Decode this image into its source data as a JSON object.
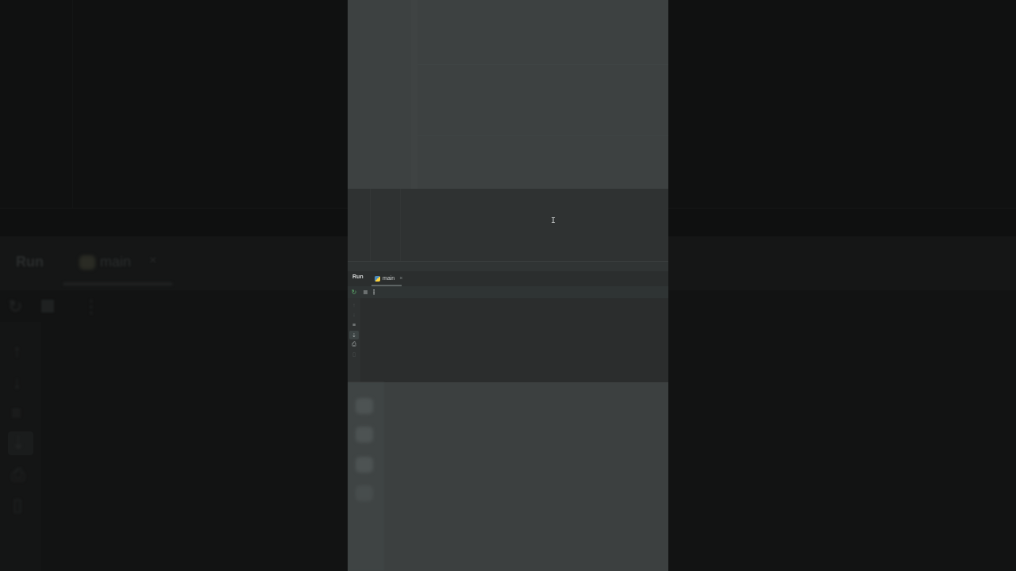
{
  "run_panel": {
    "title": "Run",
    "tab": {
      "label": "main",
      "icon": "python-icon",
      "close": "×"
    }
  },
  "toolbar": {
    "rerun_icon": "↻",
    "more_icon": "⋮"
  },
  "editor": {
    "caret_glyph": "I"
  },
  "side_tools": [
    {
      "name": "scroll-up-icon",
      "glyph": "↑"
    },
    {
      "name": "scroll-down-icon",
      "glyph": "↓"
    },
    {
      "name": "soft-wrap-icon",
      "glyph": "≡"
    },
    {
      "name": "scroll-to-end-icon",
      "glyph": "⇣"
    },
    {
      "name": "print-icon",
      "glyph": "⎙"
    },
    {
      "name": "trash-icon",
      "glyph": "▯"
    }
  ],
  "colors": {
    "accent_green": "#5fb26e",
    "python_blue": "#4b8bbe",
    "python_yellow": "#ffd43b"
  }
}
